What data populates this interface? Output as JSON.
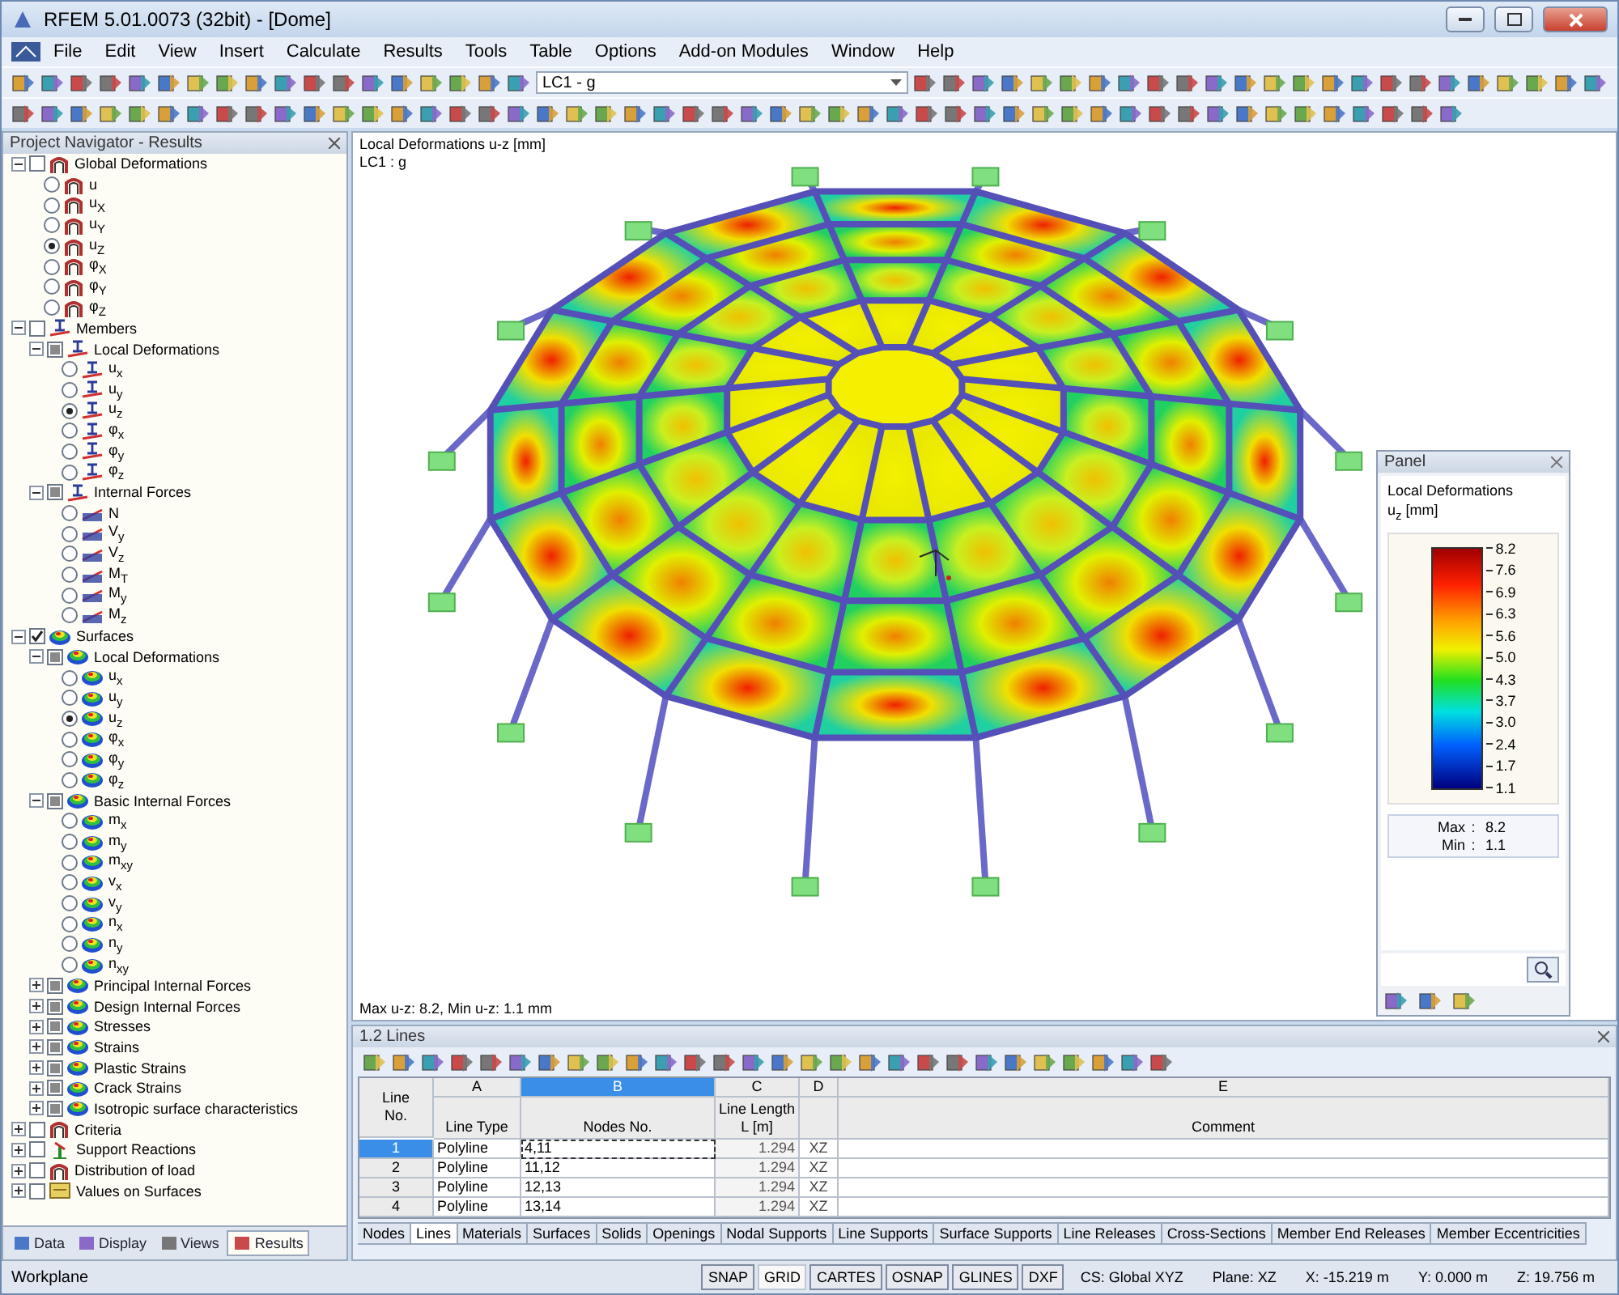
{
  "window": {
    "title": "RFEM 5.01.0073 (32bit) - [Dome]"
  },
  "menu": [
    "File",
    "Edit",
    "View",
    "Insert",
    "Calculate",
    "Results",
    "Tools",
    "Table",
    "Options",
    "Add-on Modules",
    "Window",
    "Help"
  ],
  "toolbar": {
    "load_case": "LC1 - g"
  },
  "navigator": {
    "title": "Project Navigator - Results",
    "tree": [
      {
        "label": "Global Deformations",
        "kind": "global",
        "checked": false,
        "partial": false,
        "expanded": true,
        "children": [
          {
            "label": "u",
            "kind": "global",
            "selected": false
          },
          {
            "label": "u$_{X}$",
            "kind": "global",
            "selected": false
          },
          {
            "label": "u$_{Y}$",
            "kind": "global",
            "selected": false
          },
          {
            "label": "u$_{Z}$",
            "kind": "global",
            "selected": true
          },
          {
            "label": "φ$_{X}$",
            "kind": "global",
            "selected": false
          },
          {
            "label": "φ$_{Y}$",
            "kind": "global",
            "selected": false
          },
          {
            "label": "φ$_{Z}$",
            "kind": "global",
            "selected": false
          }
        ]
      },
      {
        "label": "Members",
        "kind": "member",
        "checked": false,
        "partial": false,
        "expanded": true,
        "children": [
          {
            "label": "Local Deformations",
            "kind": "member",
            "checked": false,
            "partial": true,
            "expanded": true,
            "children": [
              {
                "label": "u$_{x}$",
                "kind": "member",
                "selected": false
              },
              {
                "label": "u$_{y}$",
                "kind": "member",
                "selected": false
              },
              {
                "label": "u$_{z}$",
                "kind": "member",
                "selected": true
              },
              {
                "label": "φ$_{x}$",
                "kind": "member",
                "selected": false
              },
              {
                "label": "φ$_{y}$",
                "kind": "member",
                "selected": false
              },
              {
                "label": "φ$_{z}$",
                "kind": "member",
                "selected": false
              }
            ]
          },
          {
            "label": "Internal Forces",
            "kind": "member",
            "checked": false,
            "partial": true,
            "expanded": true,
            "children": [
              {
                "label": "N",
                "kind": "force",
                "selected": false
              },
              {
                "label": "V$_{y}$",
                "kind": "force",
                "selected": false
              },
              {
                "label": "V$_{z}$",
                "kind": "force",
                "selected": false
              },
              {
                "label": "M$_{T}$",
                "kind": "force",
                "selected": false
              },
              {
                "label": "M$_{y}$",
                "kind": "force",
                "selected": false
              },
              {
                "label": "M$_{z}$",
                "kind": "force",
                "selected": false
              }
            ]
          }
        ]
      },
      {
        "label": "Surfaces",
        "kind": "surface",
        "checked": true,
        "partial": false,
        "expanded": true,
        "children": [
          {
            "label": "Local Deformations",
            "kind": "surface",
            "checked": false,
            "partial": true,
            "expanded": true,
            "children": [
              {
                "label": "u$_{x}$",
                "kind": "surface",
                "selected": false
              },
              {
                "label": "u$_{y}$",
                "kind": "surface",
                "selected": false
              },
              {
                "label": "u$_{z}$",
                "kind": "surface",
                "selected": true
              },
              {
                "label": "φ$_{x}$",
                "kind": "surface",
                "selected": false
              },
              {
                "label": "φ$_{y}$",
                "kind": "surface",
                "selected": false
              },
              {
                "label": "φ$_{z}$",
                "kind": "surface",
                "selected": false
              }
            ]
          },
          {
            "label": "Basic Internal Forces",
            "kind": "surface",
            "checked": false,
            "partial": true,
            "expanded": true,
            "children": [
              {
                "label": "m$_{x}$",
                "kind": "surface",
                "selected": false
              },
              {
                "label": "m$_{y}$",
                "kind": "surface",
                "selected": false
              },
              {
                "label": "m$_{xy}$",
                "kind": "surface",
                "selected": false
              },
              {
                "label": "v$_{x}$",
                "kind": "surface",
                "selected": false
              },
              {
                "label": "v$_{y}$",
                "kind": "surface",
                "selected": false
              },
              {
                "label": "n$_{x}$",
                "kind": "surface",
                "selected": false
              },
              {
                "label": "n$_{y}$",
                "kind": "surface",
                "selected": false
              },
              {
                "label": "n$_{xy}$",
                "kind": "surface",
                "selected": false
              }
            ]
          },
          {
            "label": "Principal Internal Forces",
            "kind": "surface",
            "checked": false,
            "partial": true,
            "expanded": false
          },
          {
            "label": "Design Internal Forces",
            "kind": "surface",
            "checked": false,
            "partial": true,
            "expanded": false
          },
          {
            "label": "Stresses",
            "kind": "surface",
            "checked": false,
            "partial": true,
            "expanded": false
          },
          {
            "label": "Strains",
            "kind": "surface",
            "checked": false,
            "partial": true,
            "expanded": false
          },
          {
            "label": "Plastic Strains",
            "kind": "surface",
            "checked": false,
            "partial": true,
            "expanded": false
          },
          {
            "label": "Crack Strains",
            "kind": "surface",
            "checked": false,
            "partial": true,
            "expanded": false
          },
          {
            "label": "Isotropic surface characteristics",
            "kind": "surface",
            "checked": false,
            "partial": true,
            "expanded": false
          }
        ]
      },
      {
        "label": "Criteria",
        "kind": "global",
        "checked": false,
        "partial": false,
        "expanded": false
      },
      {
        "label": "Support Reactions",
        "kind": "support",
        "checked": false,
        "partial": false,
        "expanded": false
      },
      {
        "label": "Distribution of load",
        "kind": "global",
        "checked": false,
        "partial": false,
        "expanded": false
      },
      {
        "label": "Values on Surfaces",
        "kind": "values",
        "checked": false,
        "partial": false,
        "expanded": false
      }
    ],
    "tabs": [
      {
        "label": "Data",
        "selected": false
      },
      {
        "label": "Display",
        "selected": false
      },
      {
        "label": "Views",
        "selected": false
      },
      {
        "label": "Results",
        "selected": true
      }
    ]
  },
  "viewport": {
    "title": "Local Deformations u-z [mm]",
    "load_case": "LC1 : g",
    "summary": "Max u-z: 8.2, Min u-z: 1.1 mm"
  },
  "panel": {
    "title": "Panel",
    "heading": "Local Deformations",
    "unit": "u$_{z}$ [mm]",
    "scale": [
      "8.2",
      "7.6",
      "6.9",
      "6.3",
      "5.6",
      "5.0",
      "4.3",
      "3.7",
      "3.0",
      "2.4",
      "1.7",
      "1.1"
    ],
    "max_label": "Max",
    "separator": ":",
    "max_value": "8.2",
    "min_label": "Min",
    "min_value": "1.1"
  },
  "table": {
    "title": "1.2 Lines",
    "row_header": [
      "Line",
      "No."
    ],
    "columns": [
      {
        "letter": "A",
        "header": [
          "Line Type"
        ],
        "selected": false
      },
      {
        "letter": "B",
        "header": [
          "Nodes No."
        ],
        "selected": true
      },
      {
        "letter": "C",
        "header": [
          "Line Length",
          "L [m]"
        ],
        "selected": false
      },
      {
        "letter": "D",
        "selected": false
      },
      {
        "letter": "E",
        "header": [
          "Comment"
        ],
        "selected": false
      }
    ],
    "rows": [
      {
        "no": "1",
        "line_type": "Polyline",
        "nodes": "4,11",
        "length": "1.294",
        "plane": "XZ",
        "selected": true
      },
      {
        "no": "2",
        "line_type": "Polyline",
        "nodes": "11,12",
        "length": "1.294",
        "plane": "XZ",
        "selected": false
      },
      {
        "no": "3",
        "line_type": "Polyline",
        "nodes": "12,13",
        "length": "1.294",
        "plane": "XZ",
        "selected": false
      },
      {
        "no": "4",
        "line_type": "Polyline",
        "nodes": "13,14",
        "length": "1.294",
        "plane": "XZ",
        "selected": false
      }
    ],
    "tabs": [
      {
        "label": "Nodes",
        "selected": false
      },
      {
        "label": "Lines",
        "selected": true
      },
      {
        "label": "Materials",
        "selected": false
      },
      {
        "label": "Surfaces",
        "selected": false
      },
      {
        "label": "Solids",
        "selected": false
      },
      {
        "label": "Openings",
        "selected": false
      },
      {
        "label": "Nodal Supports",
        "selected": false
      },
      {
        "label": "Line Supports",
        "selected": false
      },
      {
        "label": "Surface Supports",
        "selected": false
      },
      {
        "label": "Line Releases",
        "selected": false
      },
      {
        "label": "Cross-Sections",
        "selected": false
      },
      {
        "label": "Member End Releases",
        "selected": false
      },
      {
        "label": "Member Eccentricities",
        "selected": false
      }
    ]
  },
  "status_bar": {
    "label": "Workplane",
    "toggles": [
      {
        "label": "SNAP",
        "on": false
      },
      {
        "label": "GRID",
        "on": true
      },
      {
        "label": "CARTES",
        "on": false
      },
      {
        "label": "OSNAP",
        "on": false
      },
      {
        "label": "GLINES",
        "on": false
      },
      {
        "label": "DXF",
        "on": false
      }
    ],
    "fields": [
      "CS: Global XYZ",
      "Plane: XZ",
      "X:  -15.219 m",
      "Y:  0.000 m",
      "Z:  19.756 m"
    ]
  }
}
